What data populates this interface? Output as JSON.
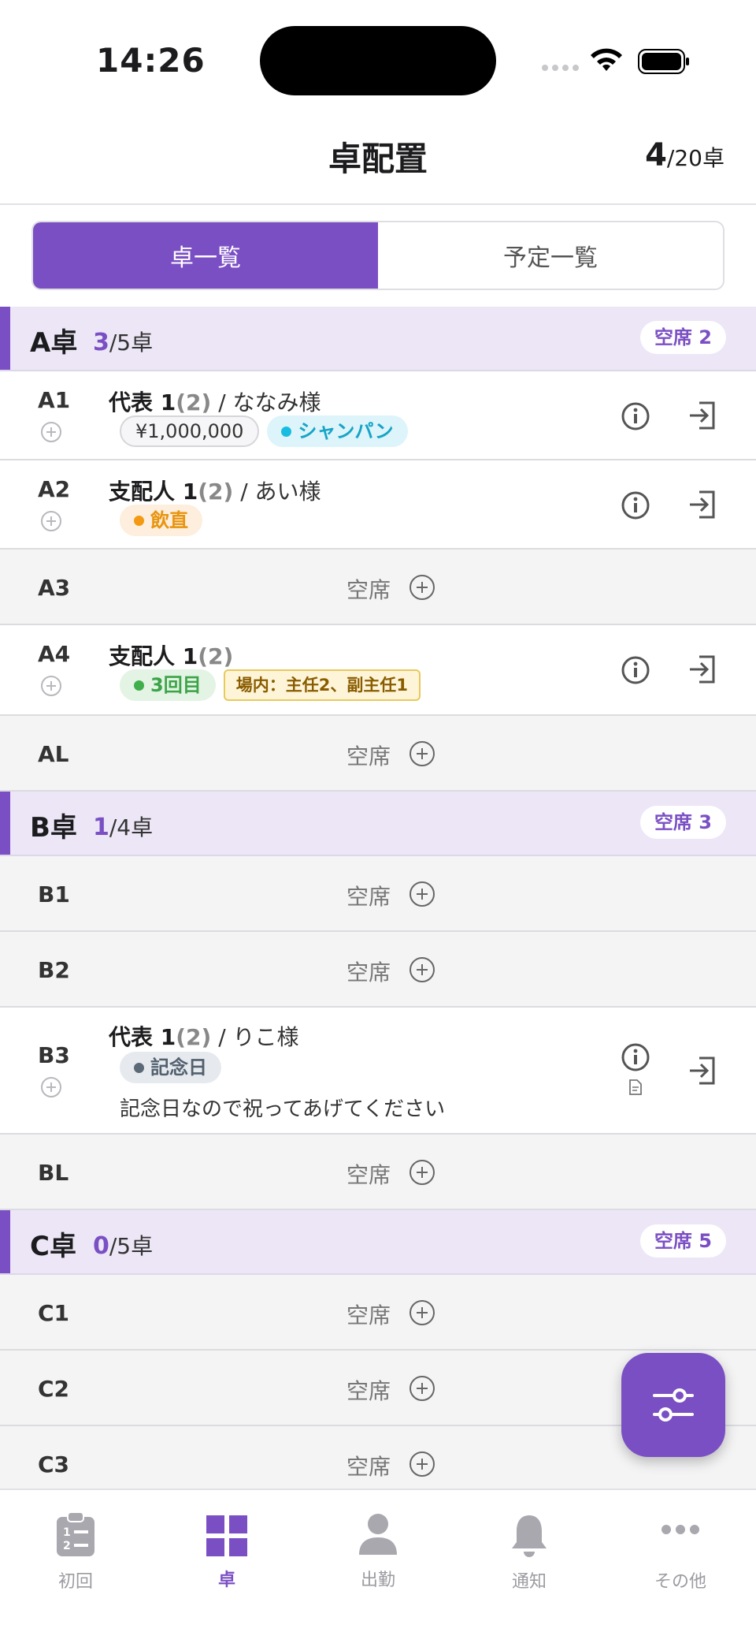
{
  "status_bar": {
    "time": "14:26"
  },
  "header": {
    "title": "卓配置",
    "count_current": "4",
    "count_total": "/20卓"
  },
  "segments": {
    "list_label": "卓一覧",
    "schedule_label": "予定一覧"
  },
  "empty_label": "空席",
  "groups": [
    {
      "name": "A卓",
      "used": "3",
      "total": "/5卓",
      "vacant": "空席 2",
      "seats": [
        {
          "id": "A1",
          "cast": "代表 1",
          "cast_n": "(2)",
          "guest": " / ななみ様",
          "price": "¥1,000,000",
          "tag": "シャンパン"
        },
        {
          "id": "A2",
          "cast": "支配人 1",
          "cast_n": "(2)",
          "guest": " / あい様",
          "tag": "飲直"
        },
        {
          "id": "A3"
        },
        {
          "id": "A4",
          "cast": "支配人 1",
          "cast_n": "(2)",
          "tag": "3回目",
          "inner": "場内：主任2、副主任1"
        },
        {
          "id": "AL"
        }
      ]
    },
    {
      "name": "B卓",
      "used": "1",
      "total": "/4卓",
      "vacant": "空席 3",
      "seats": [
        {
          "id": "B1"
        },
        {
          "id": "B2"
        },
        {
          "id": "B3",
          "cast": "代表 1",
          "cast_n": "(2)",
          "guest": " / りこ様",
          "tag": "記念日",
          "memo": "記念日なので祝ってあげてください"
        },
        {
          "id": "BL"
        }
      ]
    },
    {
      "name": "C卓",
      "used": "0",
      "total": "/5卓",
      "vacant": "空席 5",
      "seats": [
        {
          "id": "C1"
        },
        {
          "id": "C2"
        },
        {
          "id": "C3"
        }
      ]
    }
  ],
  "tabs": [
    {
      "label": "初回",
      "icon": "clipboard-list-icon"
    },
    {
      "label": "卓",
      "icon": "grid-icon",
      "active": true
    },
    {
      "label": "出勤",
      "icon": "person-icon"
    },
    {
      "label": "通知",
      "icon": "bell-icon"
    },
    {
      "label": "その他",
      "icon": "more-dots-icon"
    }
  ],
  "colors": {
    "accent": "#7b4fc4",
    "group_bg": "#ece6f6",
    "empty_bg": "#f4f4f5"
  }
}
